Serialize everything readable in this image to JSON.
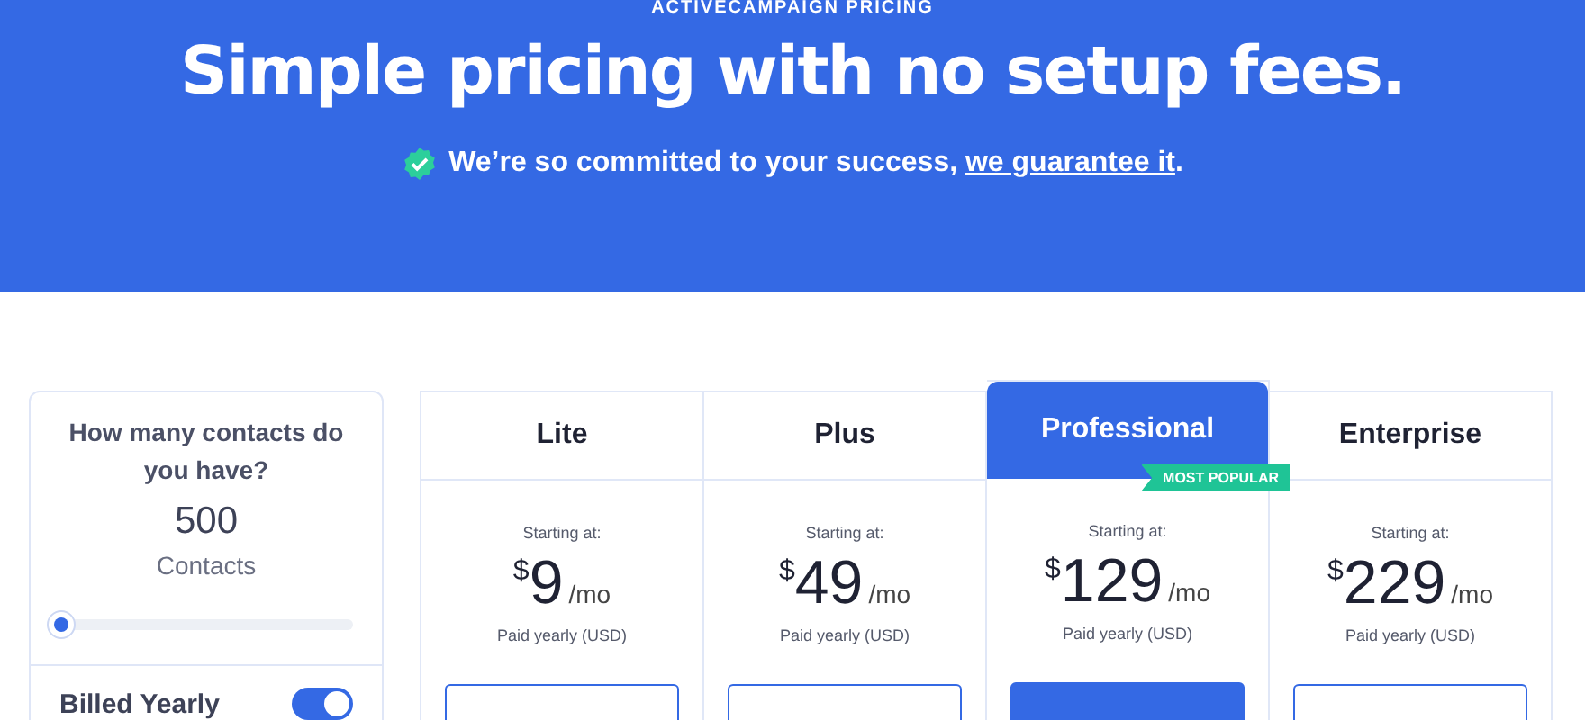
{
  "hero": {
    "eyebrow": "ACTIVECAMPAIGN PRICING",
    "title": "Simple pricing with no setup fees.",
    "guarantee_text": "We’re so committed to your success, ",
    "guarantee_link": "we guarantee it",
    "guarantee_end": "."
  },
  "contacts": {
    "question": "How many contacts do you have?",
    "count": "500",
    "unit": "Contacts",
    "level": 0
  },
  "billing": {
    "label": "Billed Yearly",
    "on": true
  },
  "plans": [
    {
      "name": "Lite",
      "selected": false,
      "starting": "Starting at:",
      "currency": "$",
      "price": "9",
      "period": "/mo",
      "note": "Paid yearly (USD)"
    },
    {
      "name": "Plus",
      "selected": false,
      "starting": "Starting at:",
      "currency": "$",
      "price": "49",
      "period": "/mo",
      "note": "Paid yearly (USD)"
    },
    {
      "name": "Professional",
      "selected": true,
      "badge": "MOST POPULAR",
      "starting": "Starting at:",
      "currency": "$",
      "price": "129",
      "period": "/mo",
      "note": "Paid yearly (USD)"
    },
    {
      "name": "Enterprise",
      "selected": false,
      "starting": "Starting at:",
      "currency": "$",
      "price": "229",
      "period": "/mo",
      "note": "Paid yearly (USD)"
    }
  ]
}
